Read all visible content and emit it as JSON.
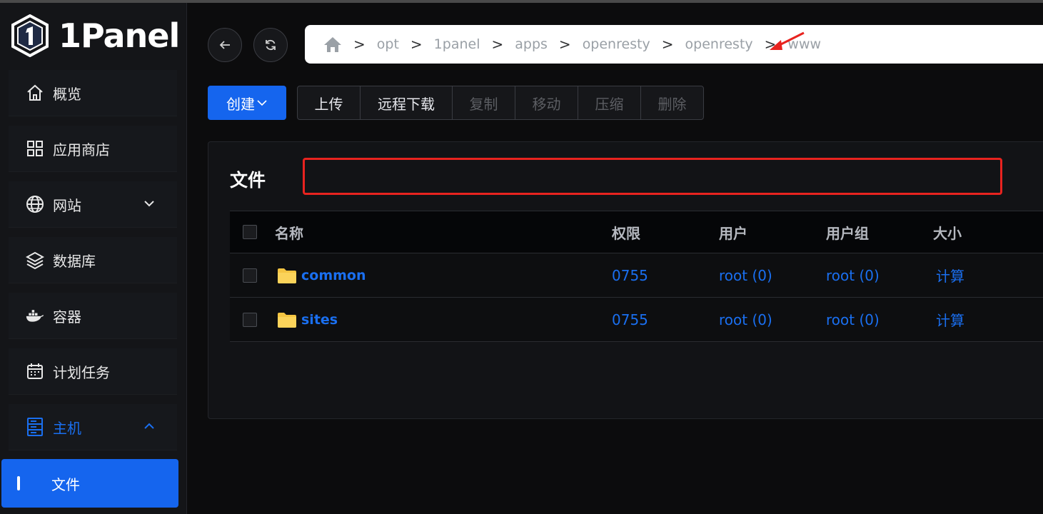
{
  "app": {
    "logo_text": "1Panel"
  },
  "sidebar": {
    "items": [
      {
        "label": "概览",
        "icon": "home-icon"
      },
      {
        "label": "应用商店",
        "icon": "grid-icon"
      },
      {
        "label": "网站",
        "icon": "globe-icon"
      },
      {
        "label": "数据库",
        "icon": "layers-icon"
      },
      {
        "label": "容器",
        "icon": "docker-icon"
      },
      {
        "label": "计划任务",
        "icon": "calendar-icon"
      },
      {
        "label": "主机",
        "icon": "server-icon"
      }
    ],
    "selected": {
      "label": "文件"
    }
  },
  "breadcrumb": {
    "home_icon": "home-icon",
    "separator": ">",
    "parts": [
      "opt",
      "1panel",
      "apps",
      "openresty",
      "openresty",
      "www"
    ]
  },
  "toolbar": {
    "create": "创建",
    "upload": "上传",
    "remote_download": "远程下载",
    "copy": "复制",
    "move": "移动",
    "compress": "压缩",
    "delete": "删除"
  },
  "card": {
    "title": "文件"
  },
  "table": {
    "headers": {
      "name": "名称",
      "perm": "权限",
      "user": "用户",
      "group": "用户组",
      "size": "大小"
    },
    "rows": [
      {
        "name": "common",
        "perm": "0755",
        "user": "root (0)",
        "group": "root (0)",
        "size": "计算"
      },
      {
        "name": "sites",
        "perm": "0755",
        "user": "root (0)",
        "group": "root (0)",
        "size": "计算"
      }
    ]
  },
  "colors": {
    "accent": "#1565ee",
    "annotation": "#e8231f",
    "folder": "#f5c542"
  }
}
